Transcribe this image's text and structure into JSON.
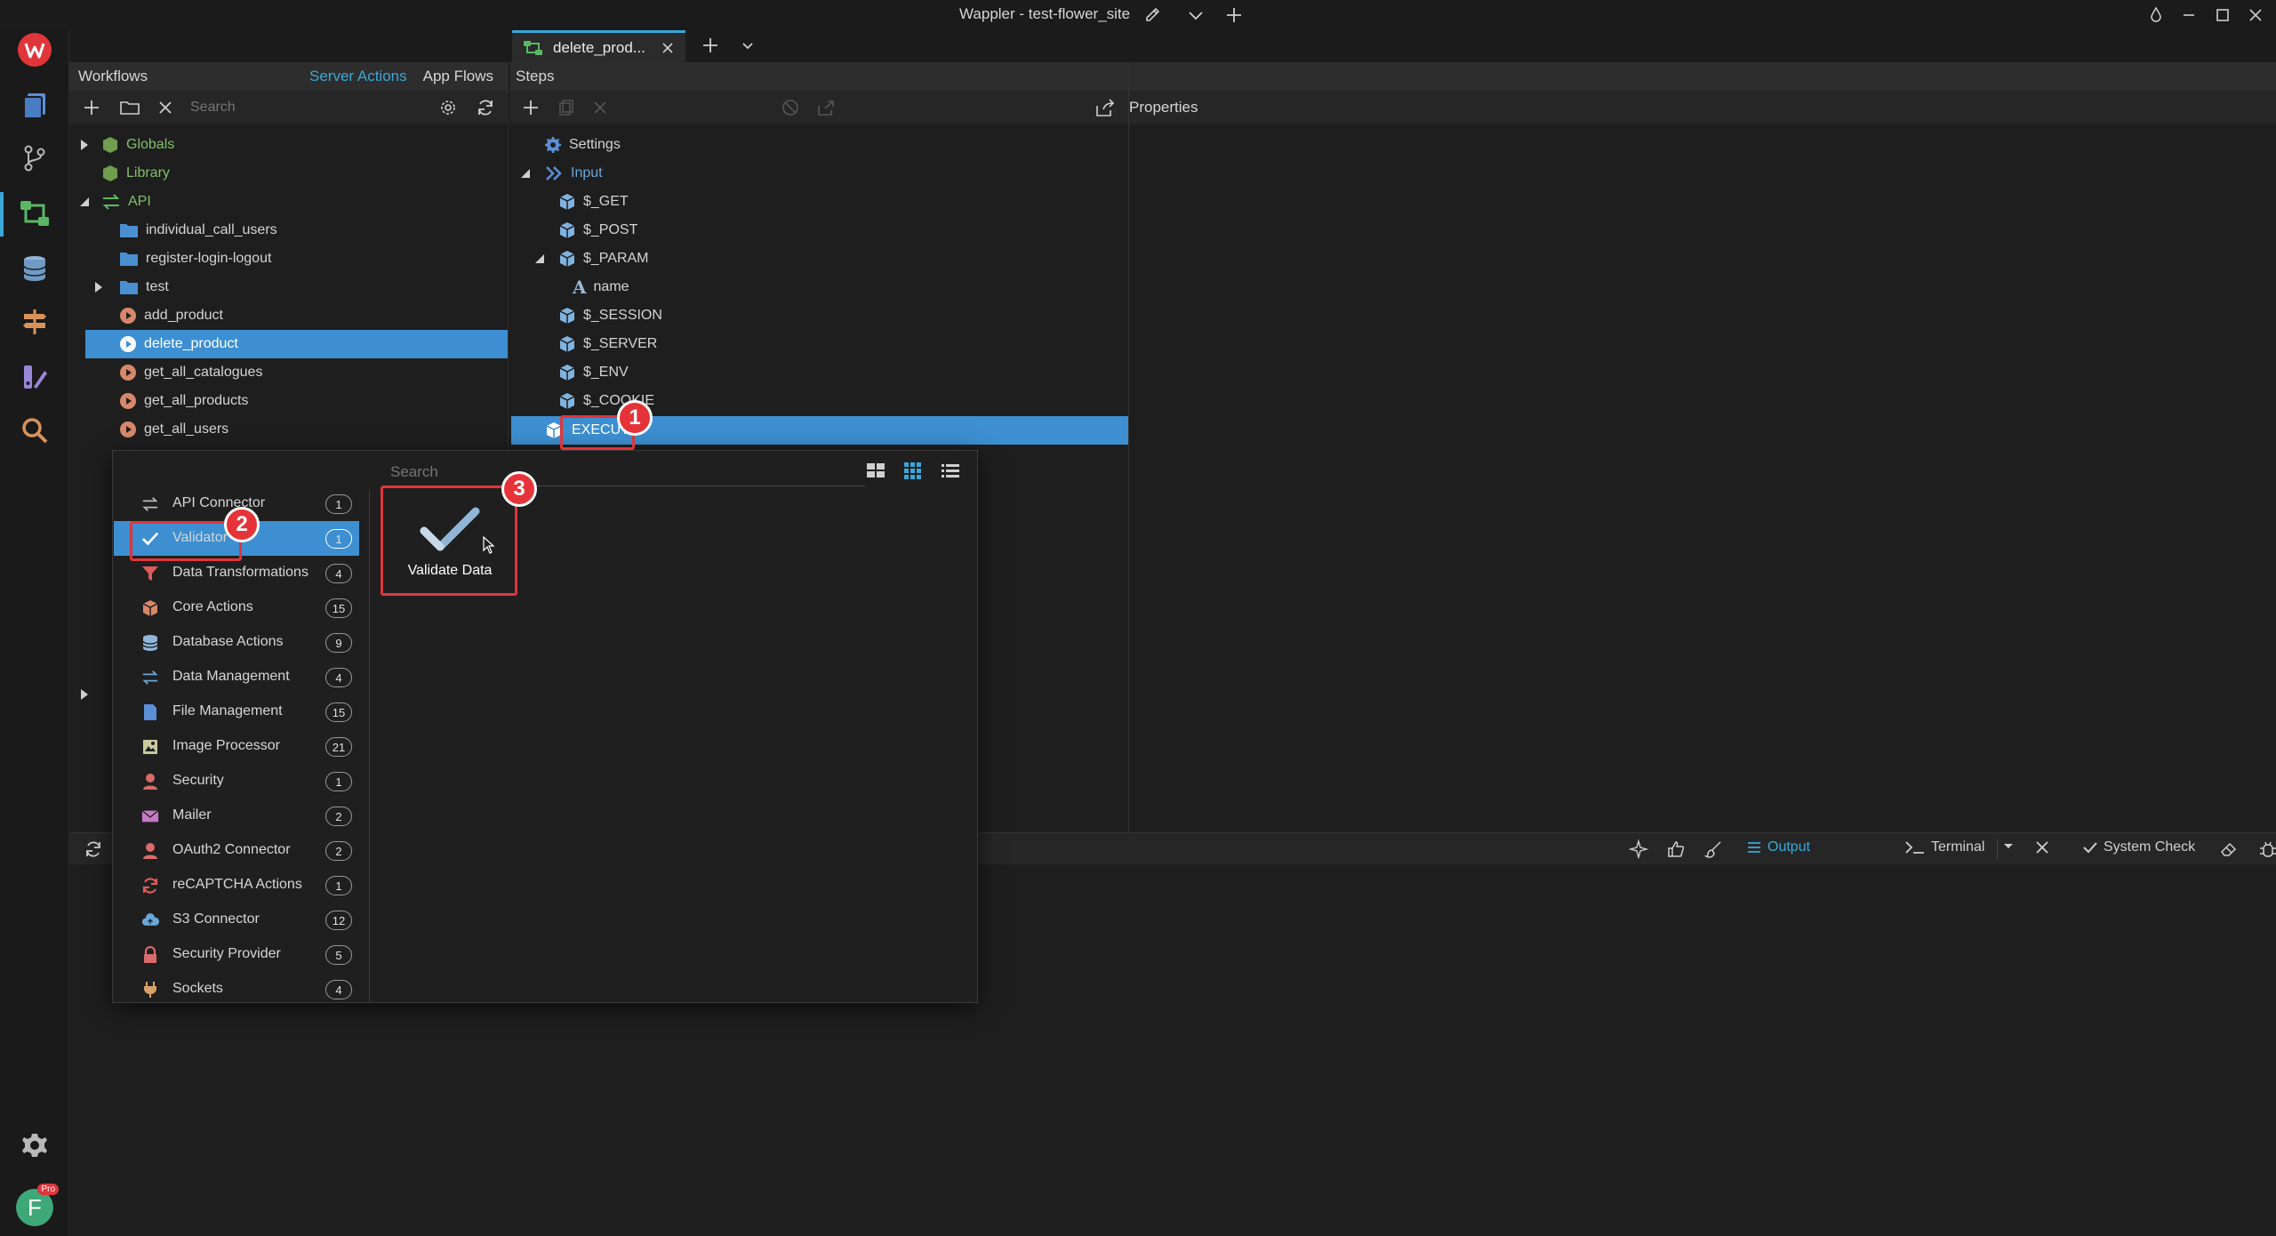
{
  "window": {
    "title": "Wappler - test-flower_site"
  },
  "tabs": [
    {
      "label": "delete_prod..."
    }
  ],
  "workflows": {
    "header": "Workflows",
    "tabs": [
      {
        "label": "Server Actions"
      },
      {
        "label": "App Flows"
      }
    ],
    "search_placeholder": "Search",
    "tree": [
      {
        "label": "Globals"
      },
      {
        "label": "Library"
      },
      {
        "label": "API"
      },
      {
        "label": "individual_call_users"
      },
      {
        "label": "register-login-logout"
      },
      {
        "label": "test"
      },
      {
        "label": "add_product"
      },
      {
        "label": "delete_product"
      },
      {
        "label": "get_all_catalogues"
      },
      {
        "label": "get_all_products"
      },
      {
        "label": "get_all_users"
      }
    ]
  },
  "steps": {
    "header": "Steps",
    "tree": [
      {
        "label": "Settings"
      },
      {
        "label": "Input"
      },
      {
        "label": "$_GET"
      },
      {
        "label": "$_POST"
      },
      {
        "label": "$_PARAM"
      },
      {
        "label": "name"
      },
      {
        "label": "$_SESSION"
      },
      {
        "label": "$_SERVER"
      },
      {
        "label": "$_ENV"
      },
      {
        "label": "$_COOKIE"
      },
      {
        "label": "EXECUTE"
      }
    ]
  },
  "properties": {
    "header": "Properties"
  },
  "output_bar": {
    "output_label": "Output",
    "terminal_label": "Terminal",
    "system_check_label": "System Check"
  },
  "picker": {
    "search_placeholder": "Search",
    "categories": [
      {
        "label": "API Connector",
        "count": "1",
        "icon": "arrows-icon",
        "color": "#b9b9b9"
      },
      {
        "label": "Validator",
        "count": "1",
        "icon": "check-icon",
        "color": "#ffffff"
      },
      {
        "label": "Data Transformations",
        "count": "4",
        "icon": "funnel-icon",
        "color": "#e05a5a"
      },
      {
        "label": "Core Actions",
        "count": "15",
        "icon": "cube-icon",
        "color": "#d8886a"
      },
      {
        "label": "Database Actions",
        "count": "9",
        "icon": "database-icon",
        "color": "#8fb5d8"
      },
      {
        "label": "Data Management",
        "count": "4",
        "icon": "arrows-icon",
        "color": "#6aa6d8"
      },
      {
        "label": "File Management",
        "count": "15",
        "icon": "file-icon",
        "color": "#5b8fd8"
      },
      {
        "label": "Image Processor",
        "count": "21",
        "icon": "image-icon",
        "color": "#c9c9a0"
      },
      {
        "label": "Security",
        "count": "1",
        "icon": "user-icon",
        "color": "#d86b6b"
      },
      {
        "label": "Mailer",
        "count": "2",
        "icon": "mail-icon",
        "color": "#c678c6"
      },
      {
        "label": "OAuth2 Connector",
        "count": "2",
        "icon": "user-icon",
        "color": "#d86b6b"
      },
      {
        "label": "reCAPTCHA Actions",
        "count": "1",
        "icon": "refresh-icon",
        "color": "#e05a5a"
      },
      {
        "label": "S3 Connector",
        "count": "12",
        "icon": "cloud-icon",
        "color": "#6aa6d8"
      },
      {
        "label": "Security Provider",
        "count": "5",
        "icon": "lock-icon",
        "color": "#d86b6b"
      },
      {
        "label": "Sockets",
        "count": "4",
        "icon": "plug-icon",
        "color": "#d8a06a"
      }
    ],
    "items": [
      {
        "label": "Validate Data",
        "icon": "check-icon"
      }
    ]
  },
  "annotations": [
    {
      "number": "1"
    },
    {
      "number": "2"
    },
    {
      "number": "3"
    }
  ],
  "user": {
    "avatar_letter": "F",
    "badge": "Pro"
  },
  "colors": {
    "accent": "#3aa7d8",
    "selection": "#3d8fd1",
    "highlight": "#e0353b"
  }
}
